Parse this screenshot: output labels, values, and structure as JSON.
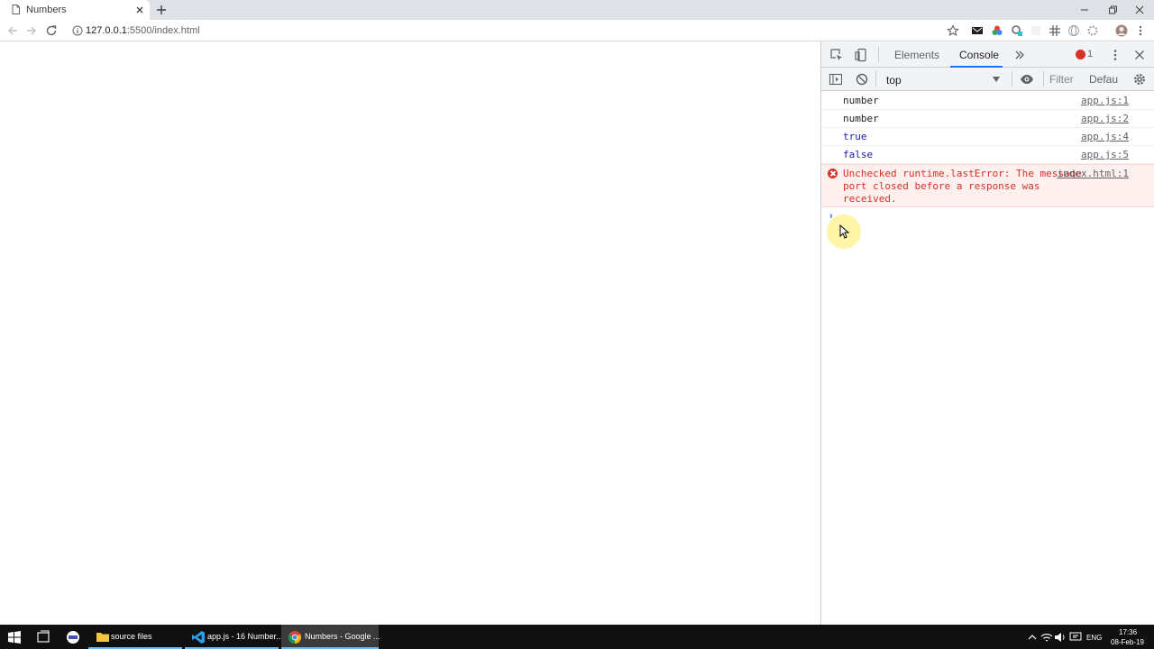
{
  "browser": {
    "tab_title": "Numbers",
    "url_host": "127.0.0.1",
    "url_rest": ":5500/index.html",
    "favicon": "page-icon",
    "accent": "#1a73e8"
  },
  "devtools": {
    "tabs": [
      {
        "label": "Elements"
      },
      {
        "label": "Console"
      }
    ],
    "error_count": "1",
    "context": "top",
    "filter_placeholder": "Filter",
    "levels_label": "Defau",
    "messages": [
      {
        "text": "number",
        "source": "app.js:1",
        "type": "log"
      },
      {
        "text": "number",
        "source": "app.js:2",
        "type": "log"
      },
      {
        "text": "true",
        "source": "app.js:4",
        "type": "boolean"
      },
      {
        "text": "false",
        "source": "app.js:5",
        "type": "boolean"
      },
      {
        "text": "Unchecked runtime.lastError: The message port closed before a response was received.",
        "source": "index.html:1",
        "type": "error"
      }
    ],
    "error_color": "#d93025"
  },
  "taskbar": {
    "apps": [
      {
        "label": "source files",
        "icon": "folder-icon"
      },
      {
        "label": "app.js - 16 Number...",
        "icon": "vscode-icon"
      },
      {
        "label": "Numbers - Google ...",
        "icon": "chrome-icon"
      }
    ],
    "language": "ENG",
    "time": "17:36",
    "date": "08-Feb-19"
  }
}
